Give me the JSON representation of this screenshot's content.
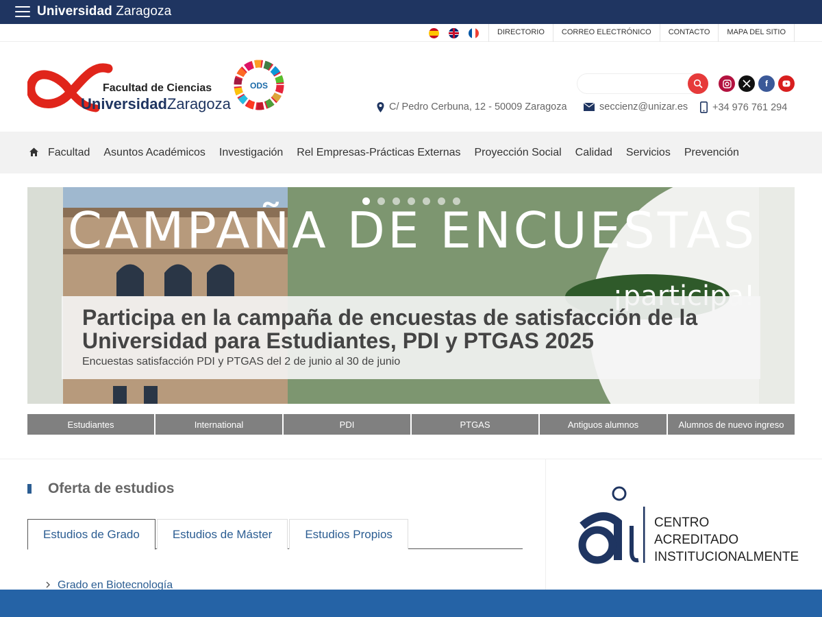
{
  "topbar": {
    "brand_bold": "Universidad",
    "brand_rest": " Zaragoza"
  },
  "languages": [
    "es",
    "en",
    "fr"
  ],
  "util_links": [
    "DIRECTORIO",
    "CORREO ELECTRÓNICO",
    "CONTACTO",
    "MAPA DEL SITIO"
  ],
  "header": {
    "logo_line1": "Facultad de Ciencias",
    "logo_line2_bold": "Universidad",
    "logo_line2_rest": "Zaragoza",
    "ods_label": "ODS",
    "search_placeholder": "",
    "social": [
      "instagram",
      "x",
      "facebook",
      "youtube"
    ],
    "address": "C/ Pedro Cerbuna, 12 - 50009 Zaragoza",
    "email": "seccienz@unizar.es",
    "phone": "+34 976 761 294"
  },
  "nav": {
    "items": [
      "Facultad",
      "Asuntos Académicos",
      "Investigación",
      "Rel Empresas-Prácticas Externas",
      "Proyección Social",
      "Calidad",
      "Servicios",
      "Prevención"
    ]
  },
  "slider": {
    "banner_text": "CAMPAÑA DE ENCUESTAS",
    "banner_badge": "¡participa!",
    "slide_count": 7,
    "active_slide": 1,
    "title": "Participa en la campaña de encuestas de satisfacción de la Universidad para Estudiantes, PDI y PTGAS 2025",
    "subtitle": "Encuestas satisfacción PDI y PTGAS del 2 de junio al 30 de junio"
  },
  "quick_links": [
    "Estudiantes",
    "International",
    "PDI",
    "PTGAS",
    "Antiguos alumnos",
    "Alumnos de nuevo ingreso"
  ],
  "studies": {
    "title": "Oferta de estudios",
    "tabs": [
      "Estudios de Grado",
      "Estudios de Máster",
      "Estudios Propios"
    ],
    "active_tab": 0,
    "items": [
      "Grado en Biotecnología"
    ]
  },
  "accreditation": {
    "line1": "CENTRO",
    "line2": "ACREDITADO",
    "line3": "INSTITUCIONALMENTE"
  },
  "colors": {
    "topbar": "#1f3561",
    "accent_red": "#e63a3a",
    "link_blue": "#2b5d92",
    "footer": "#2563a6"
  }
}
